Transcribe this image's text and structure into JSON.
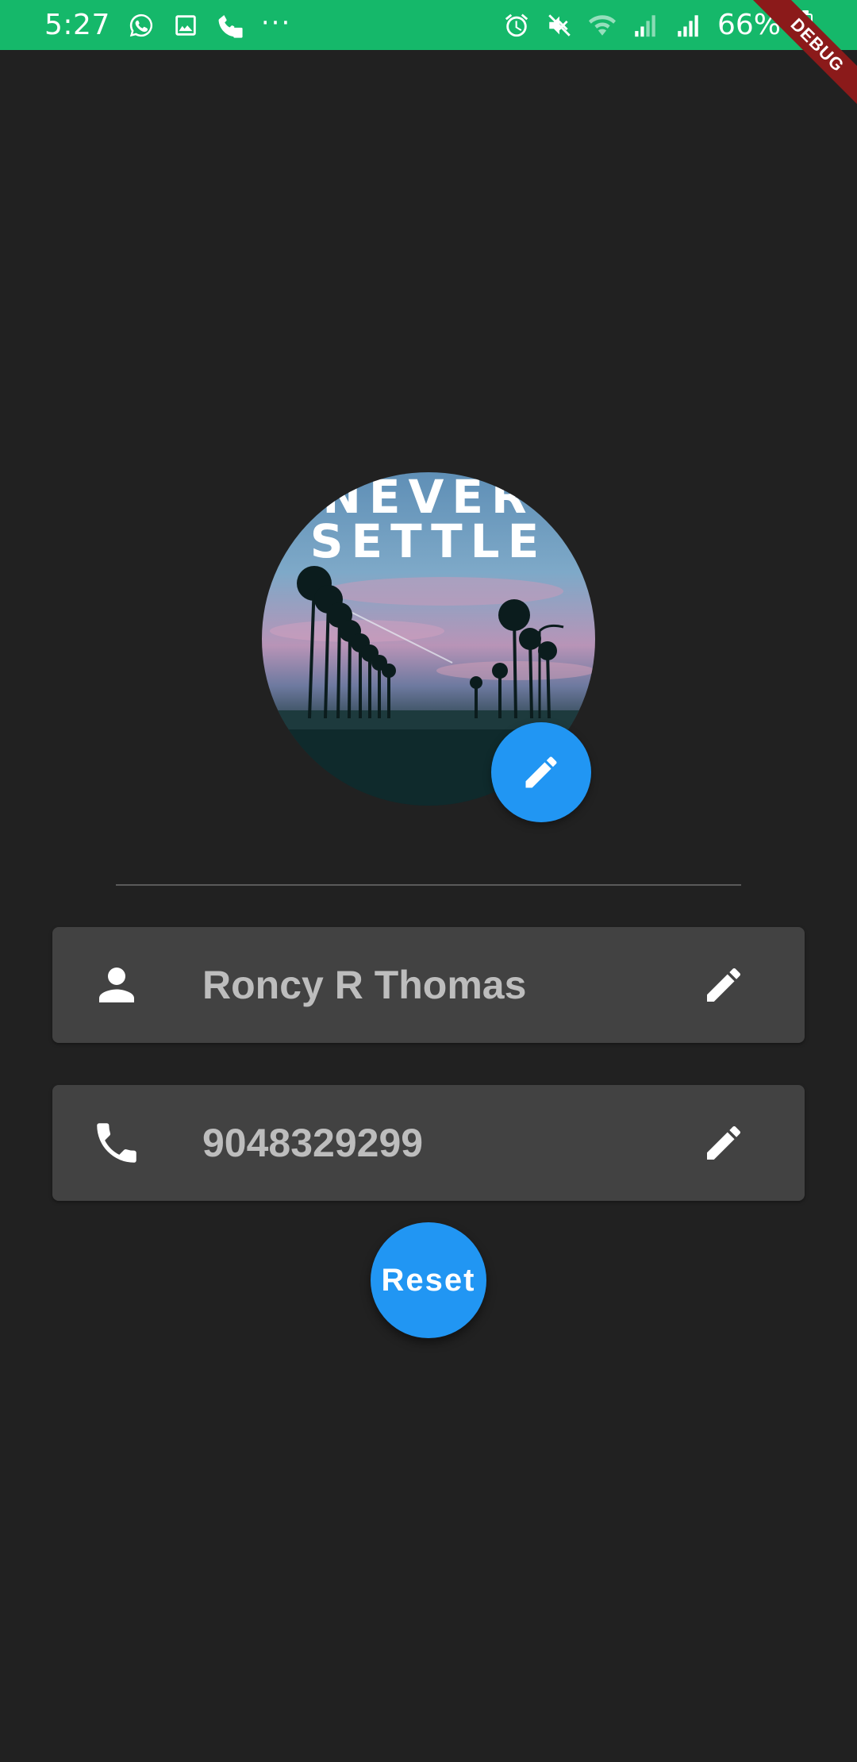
{
  "status_bar": {
    "time": "5:27",
    "dots": "···",
    "battery_percent": "66%",
    "icons_left": [
      "whatsapp-icon",
      "gallery-icon",
      "call-sim2-icon",
      "more-icon"
    ],
    "icons_right": [
      "alarm-icon",
      "mute-icon",
      "wifi-icon",
      "signal-icon",
      "signal-icon",
      "battery-icon"
    ],
    "color": "#15B86A"
  },
  "debug_banner": {
    "label": "DEBUG"
  },
  "profile": {
    "avatar_text_line1": "NEVER",
    "avatar_text_line2": "SETTLE"
  },
  "fields": {
    "name": {
      "icon": "person-icon",
      "value": "Roncy R Thomas"
    },
    "phone": {
      "icon": "phone-icon",
      "value": "9048329299"
    }
  },
  "actions": {
    "reset_label": "Reset"
  },
  "colors": {
    "background": "#212121",
    "card": "#424242",
    "accent": "#2196F3",
    "text_muted": "#BDBDBD"
  }
}
